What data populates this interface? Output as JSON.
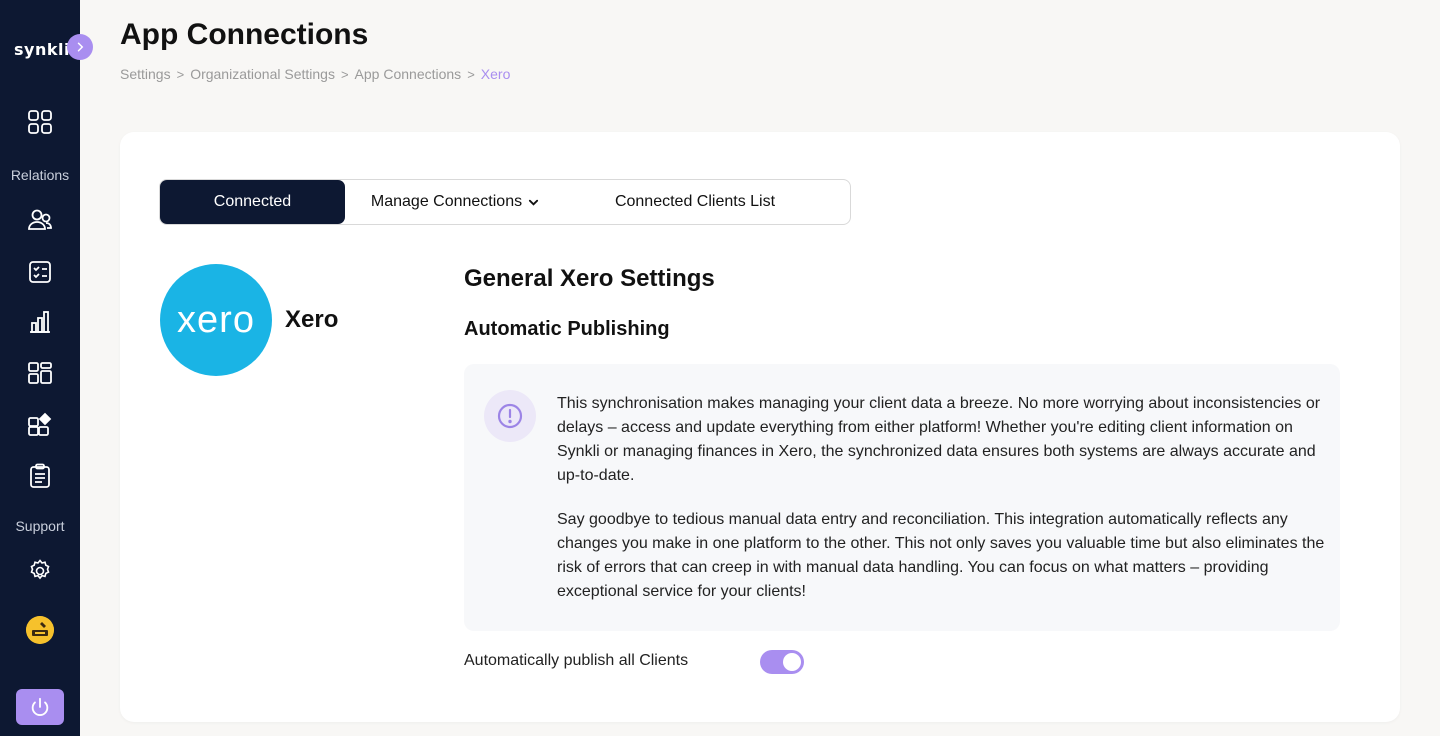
{
  "app": {
    "logo_text": "synkli"
  },
  "sidebar": {
    "sections": {
      "relations": "Relations",
      "support": "Support"
    },
    "items": [
      {
        "icon": "dashboard-grid-icon"
      },
      {
        "icon": "users-icon"
      },
      {
        "icon": "tasks-checklist-icon"
      },
      {
        "icon": "bar-chart-icon"
      },
      {
        "icon": "apps-layout-icon"
      },
      {
        "icon": "app-add-icon"
      },
      {
        "icon": "clipboard-list-icon"
      },
      {
        "icon": "gear-icon"
      }
    ],
    "accent": "#a98ef0",
    "background": "#0d1832"
  },
  "header": {
    "title": "App Connections",
    "breadcrumb": [
      "Settings",
      "Organizational Settings",
      "App Connections",
      "Xero"
    ]
  },
  "tabs": {
    "connected": "Connected",
    "manage": "Manage Connections",
    "clients": "Connected Clients List"
  },
  "integration": {
    "logo_text": "xero",
    "name": "Xero",
    "brand_color": "#1ab4e5"
  },
  "settings": {
    "title": "General Xero Settings",
    "subtitle": "Automatic Publishing",
    "paragraph1": "This synchronisation makes managing your client data a breeze. No more worrying about inconsistencies or delays – access and update everything from either platform! Whether you're editing client information on Synkli or managing finances in Xero, the synchronized data ensures both systems are always accurate and up-to-date.",
    "paragraph2": "Say goodbye to tedious manual data entry and reconciliation. This integration automatically reflects any changes you make in one platform to the other. This not only saves you valuable time but also eliminates the risk of errors that can creep in with manual data handling. You can focus on what matters – providing exceptional service for your clients!",
    "toggle_label": "Automatically publish all Clients",
    "toggle_on": true
  }
}
